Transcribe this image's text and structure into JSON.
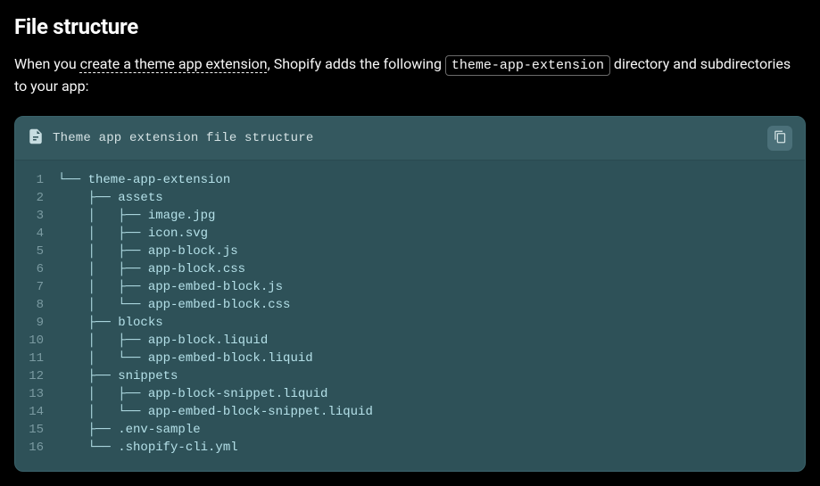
{
  "heading": "File structure",
  "intro": {
    "before_link": "When you ",
    "link_text": "create a theme app extension",
    "after_link": ", Shopify adds the following ",
    "code_token": "theme-app-extension",
    "after_code": " directory and subdirectories to your app:"
  },
  "code_block": {
    "title": "Theme app extension file structure",
    "lines": [
      "└── theme-app-extension",
      "    ├── assets",
      "    │   ├── image.jpg",
      "    │   ├── icon.svg",
      "    │   ├── app-block.js",
      "    │   ├── app-block.css",
      "    │   ├── app-embed-block.js",
      "    │   └── app-embed-block.css",
      "    ├── blocks",
      "    │   ├── app-block.liquid",
      "    │   └── app-embed-block.liquid",
      "    ├── snippets",
      "    │   ├── app-block-snippet.liquid",
      "    │   └── app-embed-block-snippet.liquid",
      "    ├── .env-sample",
      "    └── .shopify-cli.yml"
    ]
  }
}
